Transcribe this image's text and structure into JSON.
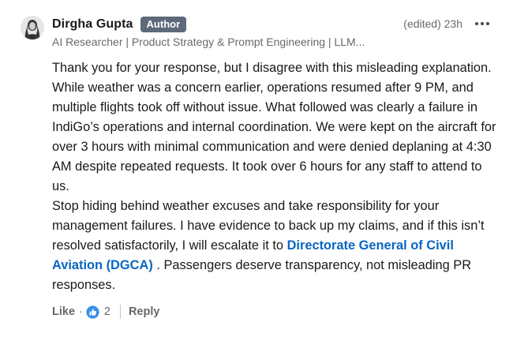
{
  "comment": {
    "author": {
      "name": "Dirgha Gupta",
      "badge": "Author",
      "headline": "AI Researcher | Product Strategy & Prompt Engineering | LLM..."
    },
    "meta": {
      "edited_time": "(edited) 23h",
      "more_icon": "more-horizontal-icon"
    },
    "body": {
      "paragraph1": "Thank you for your response, but I disagree with this misleading explanation. While weather was a concern earlier, operations resumed after 9 PM, and multiple flights took off without issue. What followed was clearly a failure in IndiGo’s operations and internal coordination. We were kept on the aircraft for over 3 hours with minimal communication and were denied deplaning at 4:30 AM despite repeated requests. It took over 6 hours for any staff to attend to us.",
      "paragraph2_before_link": "Stop hiding behind weather excuses and take responsibility for your management failures. I have evidence to back up my claims, and if this isn’t resolved satisfactorily, I will escalate it to ",
      "link_text": "Directorate General of Civil Aviation (DGCA)",
      "paragraph2_after_link": " . Passengers deserve transparency, not misleading PR responses."
    },
    "actions": {
      "like_label": "Like",
      "separator": "·",
      "like_icon": "thumbs-up-reaction-icon",
      "reaction_count": "2",
      "reply_label": "Reply"
    }
  },
  "colors": {
    "badge_bg": "#5e6a79",
    "link": "#0a66c2",
    "reaction_blue": "#378fe9"
  }
}
